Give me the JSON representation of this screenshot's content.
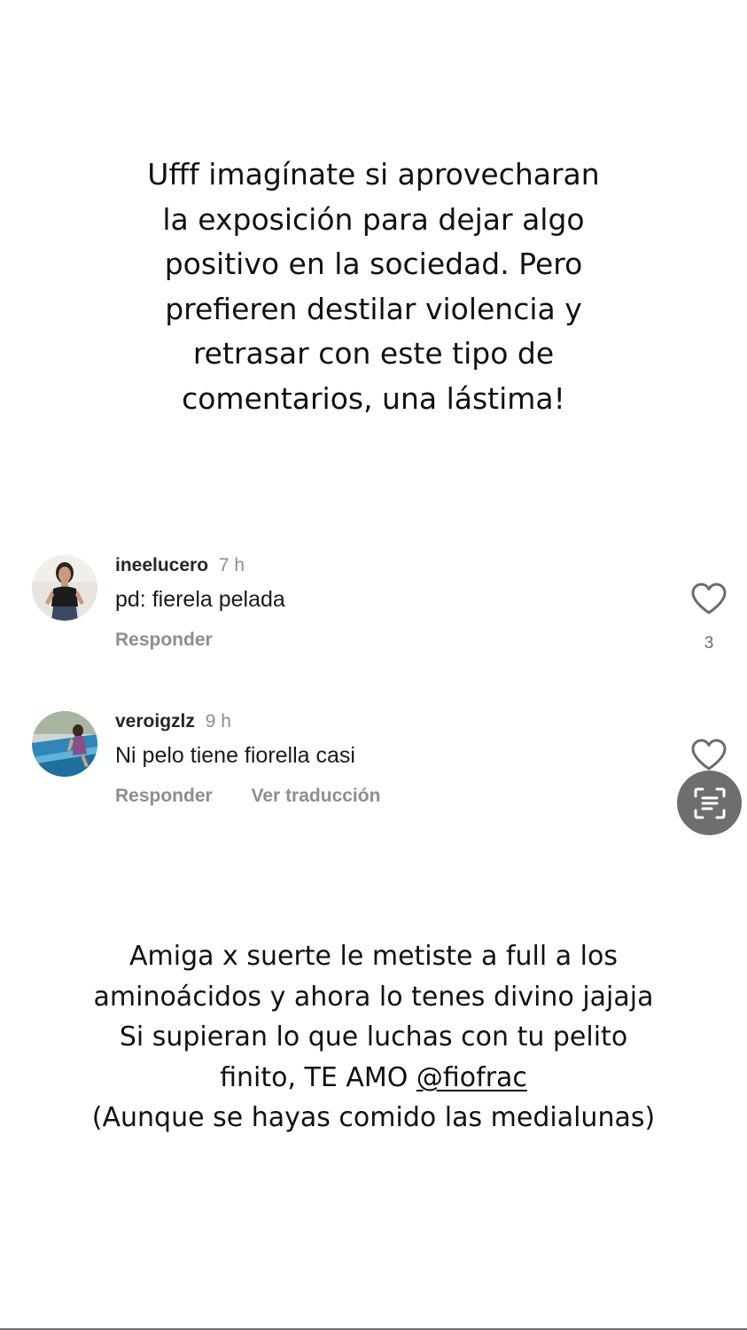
{
  "story_top": {
    "lines": [
      "Ufff imagínate si aprovecharan",
      "la exposición para dejar algo",
      "positivo en la sociedad. Pero",
      "prefieren destilar violencia y",
      "retrasar con este tipo de",
      "comentarios, una lástima!"
    ]
  },
  "comments": [
    {
      "username": "ineelucero",
      "time": "7 h",
      "text": "pd: fierela pelada",
      "reply_label": "Responder",
      "like_count": "3",
      "icons": {
        "like": "heart-icon"
      }
    },
    {
      "username": "veroigzlz",
      "time": "9 h",
      "text": "Ni pelo tiene fiorella casi",
      "reply_label": "Responder",
      "translate_label": "Ver traducción",
      "icons": {
        "like": "heart-icon"
      }
    }
  ],
  "story_bottom": {
    "line1": "Amiga x suerte le metiste a full a los",
    "line2": "aminoácidos y ahora lo tenes divino jajaja",
    "line3": "Si supieran lo que luchas con tu pelito",
    "line4_prefix": "finito, TE AMO ",
    "mention": "@fiofrac",
    "line5": "(Aunque se hayas comido las medialunas)"
  },
  "floating": {
    "scan_icon": "text-scan-icon"
  },
  "colors": {
    "username": "#262626",
    "secondary_text": "#8e8e8e",
    "scan_button_bg": "#6e6e6e"
  }
}
